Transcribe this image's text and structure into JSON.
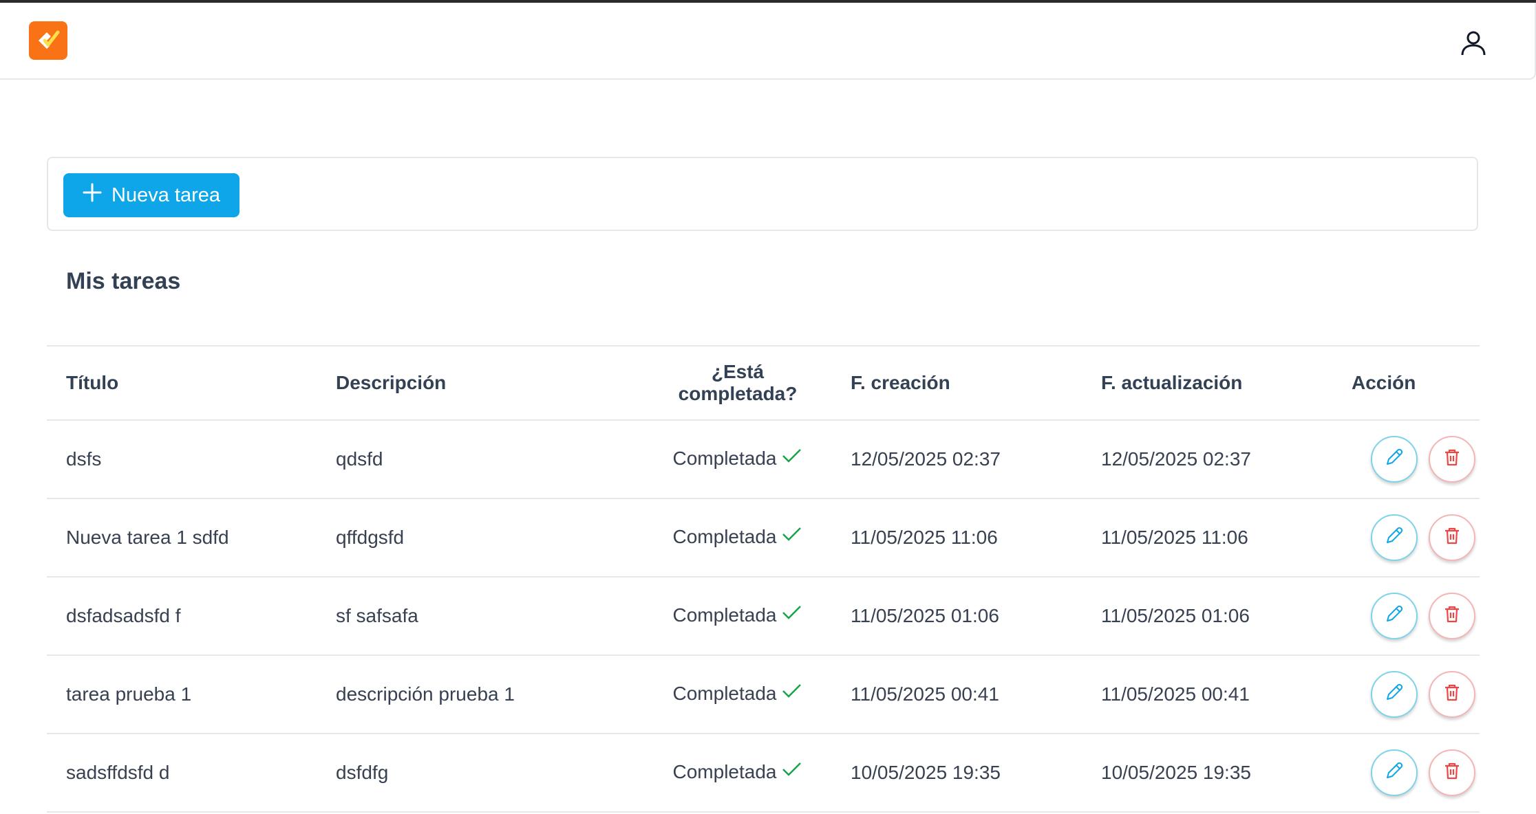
{
  "header": {
    "logo_icon": "task-check-logo-icon",
    "user_icon": "user-icon"
  },
  "toolbar": {
    "new_task_label": "Nueva tarea",
    "new_task_icon": "plus-icon"
  },
  "page": {
    "title": "Mis tareas"
  },
  "table": {
    "headers": {
      "title": "Título",
      "description": "Descripción",
      "completed_line1": "¿Está",
      "completed_line2": "completada?",
      "created": "F. creación",
      "updated": "F. actualización",
      "action": "Acción"
    },
    "rows": [
      {
        "title": "dsfs",
        "description": "qdsfd",
        "status": "Completada",
        "created": "12/05/2025 02:37",
        "updated": "12/05/2025 02:37"
      },
      {
        "title": "Nueva tarea 1 sdfd",
        "description": "qffdgsfd",
        "status": "Completada",
        "created": "11/05/2025 11:06",
        "updated": "11/05/2025 11:06"
      },
      {
        "title": "dsfadsadsfd f",
        "description": "sf safsafa",
        "status": "Completada",
        "created": "11/05/2025 01:06",
        "updated": "11/05/2025 01:06"
      },
      {
        "title": "tarea prueba 1",
        "description": "descripción prueba 1",
        "status": "Completada",
        "created": "11/05/2025 00:41",
        "updated": "11/05/2025 00:41"
      },
      {
        "title": "sadsffdsfd d",
        "description": "dsfdfg",
        "status": "Completada",
        "created": "10/05/2025 19:35",
        "updated": "10/05/2025 19:35"
      }
    ]
  },
  "colors": {
    "primary": "#0ea5e9",
    "logo": "#f97316",
    "success": "#16a34a",
    "edit": "#0ea5e9",
    "delete": "#ef4444"
  }
}
